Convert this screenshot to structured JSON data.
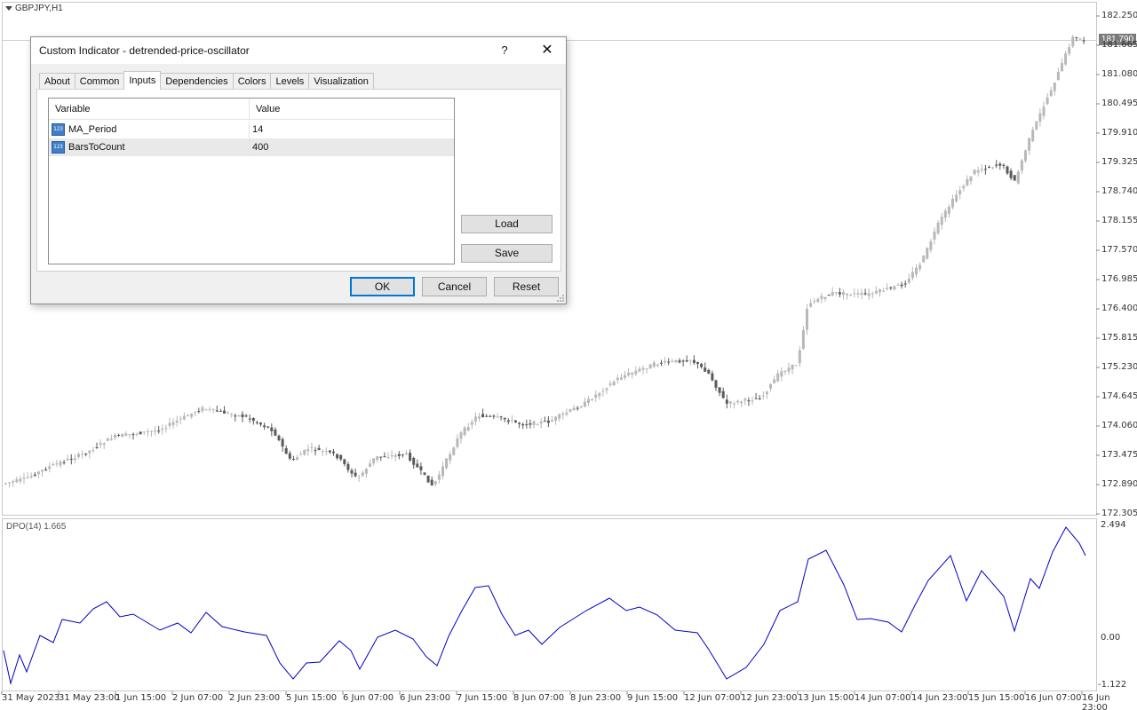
{
  "chart": {
    "symbol": "GBPJPY,H1",
    "current_price": "181.790",
    "price_axis": [
      "182.250",
      "181.665",
      "181.080",
      "180.495",
      "179.910",
      "179.325",
      "178.740",
      "178.155",
      "177.570",
      "176.985",
      "176.400",
      "175.815",
      "175.230",
      "174.645",
      "174.060",
      "173.475",
      "172.890",
      "172.305"
    ],
    "time_axis": [
      "31 May 2023",
      "31 May 23:00",
      "1 Jun 15:00",
      "2 Jun 07:00",
      "2 Jun 23:00",
      "5 Jun 15:00",
      "6 Jun 07:00",
      "6 Jun 23:00",
      "7 Jun 15:00",
      "8 Jun 07:00",
      "8 Jun 23:00",
      "9 Jun 15:00",
      "12 Jun 07:00",
      "12 Jun 23:00",
      "13 Jun 15:00",
      "14 Jun 07:00",
      "14 Jun 23:00",
      "15 Jun 15:00",
      "16 Jun 07:00",
      "16 Jun 23:00"
    ],
    "colors": {
      "candle_up": "#b8b8b8",
      "candle_down": "#5a5a5a",
      "dpo_line": "#0000c8",
      "grid": "#c8c8c8"
    }
  },
  "indicator": {
    "label": "DPO(14) 1.665",
    "axis": [
      "2.494",
      "0.00",
      "-1.122"
    ]
  },
  "dialog": {
    "title": "Custom Indicator - detrended-price-oscillator",
    "help": "?",
    "close": "✕",
    "tabs": [
      "About",
      "Common",
      "Inputs",
      "Dependencies",
      "Colors",
      "Levels",
      "Visualization"
    ],
    "active_tab": "Inputs",
    "table": {
      "headers": [
        "Variable",
        "Value"
      ],
      "rows": [
        {
          "icon": "123",
          "variable": "MA_Period",
          "value": "14"
        },
        {
          "icon": "123",
          "variable": "BarsToCount",
          "value": "400"
        }
      ]
    },
    "load_label": "Load",
    "save_label": "Save",
    "ok_label": "OK",
    "cancel_label": "Cancel",
    "reset_label": "Reset"
  }
}
